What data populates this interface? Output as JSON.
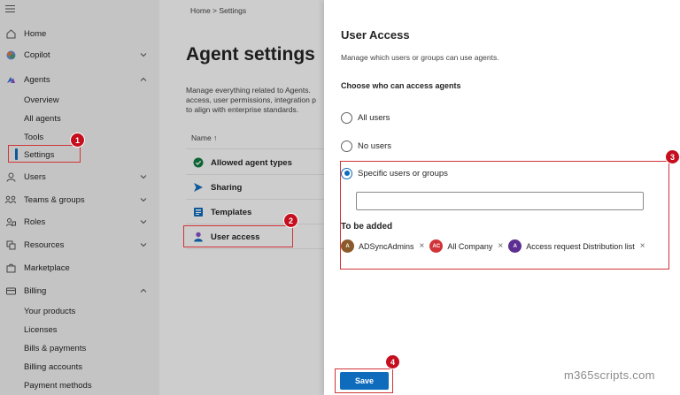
{
  "sidebar": {
    "hamburger_icon": "hamburger-icon",
    "items": [
      {
        "label": "Home",
        "icon": "home-icon"
      },
      {
        "label": "Copilot",
        "icon": "copilot-icon"
      },
      {
        "label": "Agents",
        "icon": "agents-icon"
      },
      {
        "label": "Users",
        "icon": "user-icon"
      },
      {
        "label": "Teams & groups",
        "icon": "teams-icon"
      },
      {
        "label": "Roles",
        "icon": "roles-icon"
      },
      {
        "label": "Resources",
        "icon": "resources-icon"
      },
      {
        "label": "Marketplace",
        "icon": "marketplace-icon"
      },
      {
        "label": "Billing",
        "icon": "billing-icon"
      }
    ],
    "agents_sub": [
      "Overview",
      "All agents",
      "Tools",
      "Settings"
    ],
    "billing_sub": [
      "Your products",
      "Licenses",
      "Bills & payments",
      "Billing accounts",
      "Payment methods"
    ]
  },
  "main": {
    "breadcrumb": "Home  >  Settings",
    "title": "Agent settings",
    "description_lines": [
      "Manage everything related to Agents.",
      "access, user permissions, integration p",
      "to align with enterprise standards."
    ],
    "column_header": "Name ↑",
    "rows": [
      {
        "label": "Allowed agent types",
        "icon": "check-circle-icon"
      },
      {
        "label": "Sharing",
        "icon": "share-arrow-icon"
      },
      {
        "label": "Templates",
        "icon": "template-icon"
      },
      {
        "label": "User access",
        "icon": "user-access-icon"
      }
    ]
  },
  "panel": {
    "title": "User Access",
    "description": "Manage which users or groups can use agents.",
    "choose_label": "Choose who can access agents",
    "options": [
      {
        "label": "All users",
        "checked": false
      },
      {
        "label": "No users",
        "checked": false
      },
      {
        "label": "Specific users or groups",
        "checked": true
      }
    ],
    "input_value": "",
    "to_be_added_label": "To be added",
    "chips": [
      {
        "initials": "A",
        "name": "ADSyncAdmins",
        "color": "#8b5a2b"
      },
      {
        "initials": "AC",
        "name": "All Company",
        "color": "#d13438"
      },
      {
        "initials": "A",
        "name": "Access request Distribution list",
        "color": "#5c2e91"
      }
    ],
    "remove_glyph": "×",
    "save_label": "Save"
  },
  "watermark": "m365scripts.com",
  "callouts": [
    "1",
    "2",
    "3",
    "4"
  ],
  "colors": {
    "accent": "#0f6cbd",
    "highlight": "#d13438",
    "callout": "#c50f1f"
  }
}
